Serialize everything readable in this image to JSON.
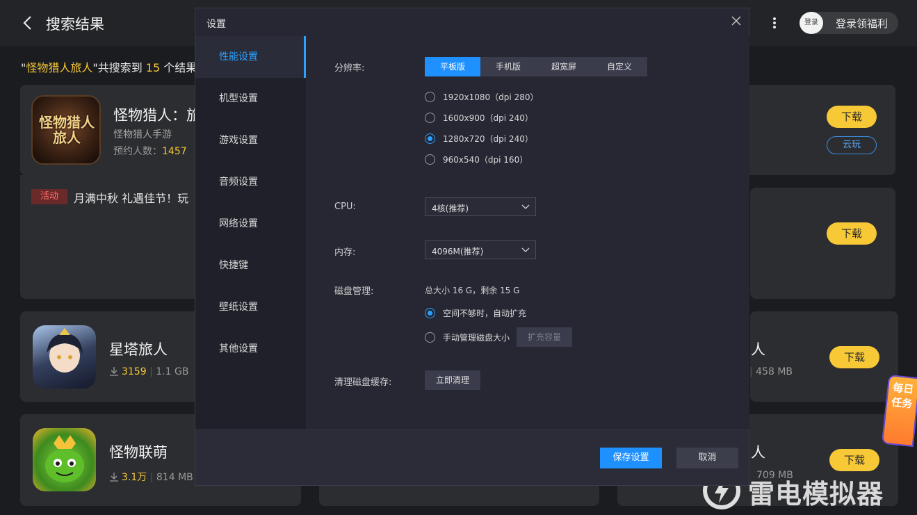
{
  "header": {
    "title": "搜索结果",
    "login_avatar": "登录",
    "login_text": "登录领福利"
  },
  "results": {
    "quote_open": "\"",
    "keyword": "怪物猎人旅人",
    "quote_mid": "\"共搜索到 ",
    "count": "15",
    "suffix": " 个结果"
  },
  "games": [
    {
      "title": "怪物猎人：旅",
      "subtitle": "怪物猎人手游",
      "meta_label": "预约人数：",
      "meta_value": "1457",
      "icon_text": "怪物猎人旅人",
      "download": "下载",
      "cloud": "云玩"
    },
    {
      "download": "下载"
    },
    {
      "title": "星塔旅人",
      "downloads": "3159",
      "size": "1.1 GB",
      "right_title": "人",
      "right_size": "458 MB",
      "download": "下载"
    },
    {
      "title": "怪物联萌",
      "downloads": "3.1万",
      "size": "814 MB",
      "right_title": "人",
      "right_size": "709 MB",
      "download": "下载"
    }
  ],
  "activity": {
    "tag": "活动",
    "text": "月满中秋 礼遇佳节！玩"
  },
  "task_badge": "每日任务",
  "watermark": "雷电模拟器",
  "dialog": {
    "title": "设置",
    "nav": [
      {
        "label": "性能设置",
        "active": true
      },
      {
        "label": "机型设置"
      },
      {
        "label": "游戏设置"
      },
      {
        "label": "音频设置"
      },
      {
        "label": "网络设置"
      },
      {
        "label": "快捷键"
      },
      {
        "label": "壁纸设置"
      },
      {
        "label": "其他设置"
      }
    ],
    "resolution_label": "分辨率:",
    "resolution_tabs": [
      "平板版",
      "手机版",
      "超宽屏",
      "自定义"
    ],
    "resolution_selected_tab": "平板版",
    "resolution_options": [
      "1920x1080（dpi 280）",
      "1600x900（dpi 240）",
      "1280x720（dpi 240）",
      "960x540（dpi 160）"
    ],
    "resolution_selected": "1280x720（dpi 240）",
    "cpu_label": "CPU:",
    "cpu_value": "4核(推荐)",
    "mem_label": "内存:",
    "mem_value": "4096M(推荐)",
    "disk_label": "磁盘管理:",
    "disk_info": "总大小 16 G，剩余 15 G",
    "disk_options": [
      "空间不够时，自动扩充",
      "手动管理磁盘大小"
    ],
    "disk_selected": "空间不够时，自动扩充",
    "expand_button": "扩充容量",
    "clear_label": "清理磁盘缓存:",
    "clear_button": "立即清理",
    "save_button": "保存设置",
    "cancel_button": "取消"
  },
  "colors": {
    "accent": "#1e90ff",
    "brand_yellow": "#f7c937",
    "dialog_bg": "#262733"
  }
}
